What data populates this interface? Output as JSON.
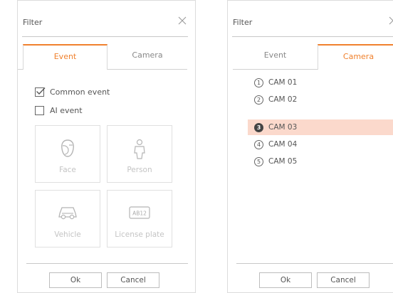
{
  "left_panel": {
    "title": "Filter",
    "tabs": [
      {
        "label": "Event",
        "active": true
      },
      {
        "label": "Camera",
        "active": false
      }
    ],
    "checkboxes": [
      {
        "label": "Common event",
        "checked": true
      },
      {
        "label": "AI event",
        "checked": false
      }
    ],
    "tiles": [
      {
        "label": "Face",
        "icon": "face-icon"
      },
      {
        "label": "Person",
        "icon": "person-icon"
      },
      {
        "label": "Vehicle",
        "icon": "vehicle-icon"
      },
      {
        "label": "License plate",
        "icon": "license-plate-icon",
        "plate_text": "AB12"
      }
    ],
    "ok_label": "Ok",
    "cancel_label": "Cancel"
  },
  "right_panel": {
    "title": "Filter",
    "tabs": [
      {
        "label": "Event",
        "active": false
      },
      {
        "label": "Camera",
        "active": true
      }
    ],
    "cameras": [
      {
        "number": "1",
        "label": "CAM 01",
        "selected": false
      },
      {
        "number": "2",
        "label": "CAM 02",
        "selected": false
      },
      {
        "number": "3",
        "label": "CAM 03",
        "selected": true
      },
      {
        "number": "4",
        "label": "CAM 04",
        "selected": false
      },
      {
        "number": "5",
        "label": "CAM 05",
        "selected": false
      }
    ],
    "ok_label": "Ok",
    "cancel_label": "Cancel"
  },
  "colors": {
    "accent": "#f0812d",
    "selected_row": "#fbd9cc",
    "disabled_text": "#c4c4c4"
  }
}
